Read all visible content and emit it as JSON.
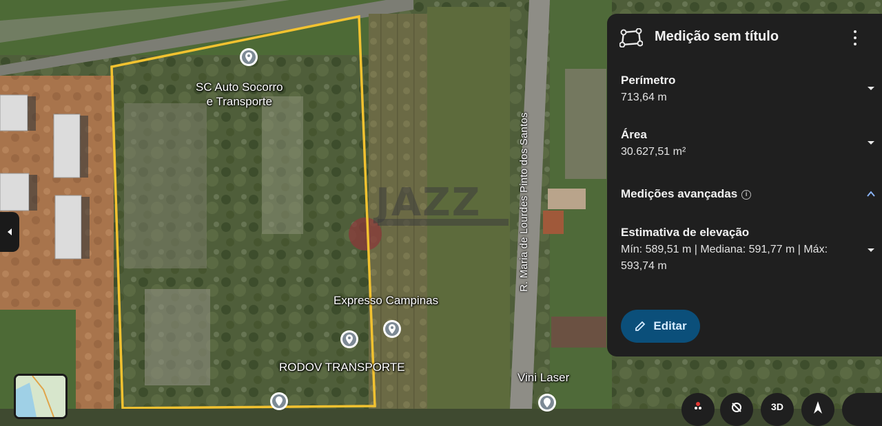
{
  "map": {
    "place_labels": [
      {
        "id": "sc-auto",
        "lines": [
          "SC Auto Socorro",
          "e Transporte"
        ]
      },
      {
        "id": "expresso",
        "lines": [
          "Expresso Campinas"
        ]
      },
      {
        "id": "rodov",
        "lines": [
          "RODOV TRANSPORTE"
        ]
      },
      {
        "id": "vini",
        "lines": [
          "Vini Laser"
        ]
      }
    ],
    "road_label": "R. Maria de Lourdes Pinto dos Santos",
    "watermark": "JAZZ",
    "colors": {
      "polygon": "#f2c230"
    }
  },
  "panel": {
    "title": "Medição sem título",
    "perimetro_label": "Perímetro",
    "perimetro_value": "713,64 m",
    "area_label": "Área",
    "area_value": "30.627,51 m²",
    "advanced_label": "Medições avançadas",
    "elevation_label": "Estimativa de elevação",
    "elevation_line1": "Mín: 589,51 m | Mediana: 591,77 m | Máx:",
    "elevation_line2": "593,74 m",
    "edit_label": "Editar",
    "accent": "#0b4f7a"
  },
  "controls": {
    "view_3d_label": "3D"
  }
}
